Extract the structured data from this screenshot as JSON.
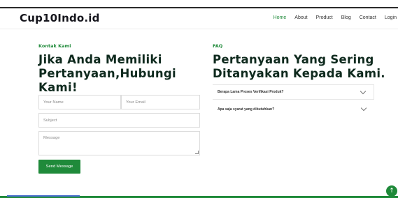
{
  "header": {
    "logo": "Cup10Indo.id",
    "nav": [
      "Home",
      "About",
      "Product",
      "Blog",
      "Contact",
      "Login"
    ],
    "active_nav": "Home"
  },
  "contact": {
    "label": "Kontak Kami",
    "title": "Jika Anda Memiliki Pertanyaan,Hubungi Kami!",
    "name_placeholder": "Your Name",
    "email_placeholder": "Your Email",
    "subject_placeholder": "Subject",
    "message_placeholder": "Message",
    "send_label": "Send Message"
  },
  "faq": {
    "label": "FAQ",
    "title": "Pertanyaan Yang Sering Ditanyakan Kepada Kami.",
    "items": [
      {
        "question": "Berapa Lama Proses Verifikasi Produk?"
      },
      {
        "question": "Apa saja syarat yang dibutuhkan?"
      }
    ]
  },
  "icons": {
    "chevron": "chevron-down-icon",
    "scroll_top": "arrow-up-icon"
  },
  "colors": {
    "accent": "#1f8a3a",
    "title": "#0f2a1e"
  }
}
